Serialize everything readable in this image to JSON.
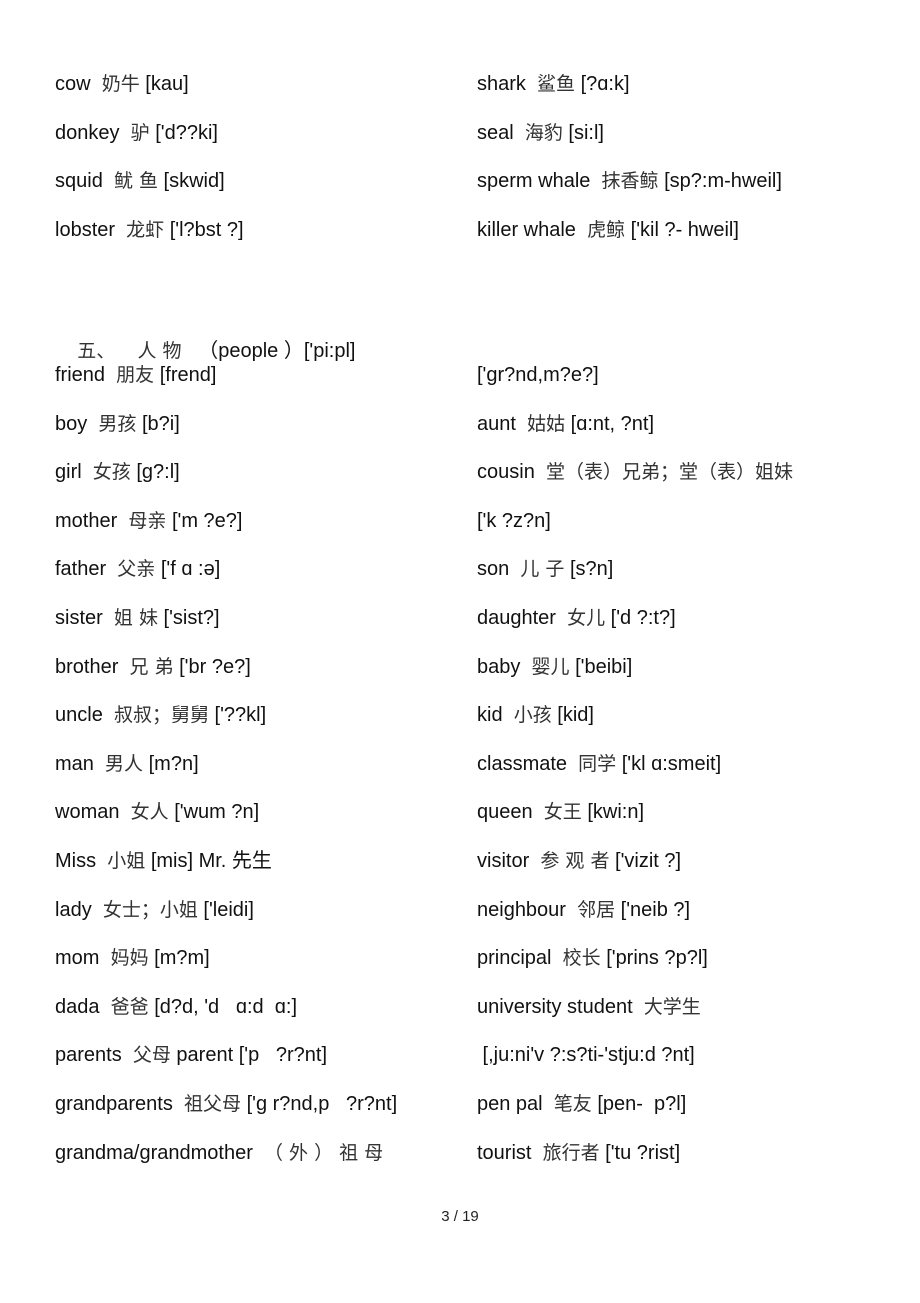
{
  "top_section": {
    "left": [
      {
        "en": "cow",
        "zh": "奶牛",
        "ipa": "[kau]"
      },
      {
        "en": "donkey",
        "zh": "驴",
        "ipa": "['d??ki]"
      },
      {
        "en": "squid",
        "zh": "鱿 鱼",
        "ipa": "[skwid]"
      },
      {
        "en": "lobster",
        "zh": "龙虾",
        "ipa": "['l?bst ?]"
      }
    ],
    "right": [
      {
        "en": "shark",
        "zh": "鲨鱼",
        "ipa": "[?ɑ:k]"
      },
      {
        "en": "seal",
        "zh": "海豹",
        "ipa": "[si:l]"
      },
      {
        "en": "sperm whale",
        "zh": "抹香鲸",
        "ipa": "[sp?:m-hweil]"
      },
      {
        "en": "killer whale",
        "zh": "虎鲸",
        "ipa": "['kil ?- hweil]"
      }
    ]
  },
  "section_heading": {
    "number": "五、",
    "title_zh": "人 物",
    "title_en": "（people ）",
    "ipa": "['pi:pl]"
  },
  "people": {
    "left": [
      {
        "en": "friend",
        "zh": "朋友",
        "ipa": "[frend]"
      },
      {
        "en": "boy",
        "zh": "男孩",
        "ipa": "[b?i]"
      },
      {
        "en": "girl",
        "zh": "女孩",
        "ipa": "[ɡ?:l]"
      },
      {
        "en": "mother",
        "zh": "母亲",
        "ipa": "['m ?e?]"
      },
      {
        "en": "father",
        "zh": "父亲",
        "ipa": "['f ɑ :ə]"
      },
      {
        "en": "sister",
        "zh": "姐 妹",
        "ipa": "['sist?]"
      },
      {
        "en": "brother",
        "zh": "兄 弟",
        "ipa": "['br ?e?]"
      },
      {
        "en": "uncle",
        "zh": "叔叔；舅舅",
        "ipa": "['??kl]"
      },
      {
        "en": "man",
        "zh": "男人",
        "ipa": "[m?n]"
      },
      {
        "en": "woman",
        "zh": "女人",
        "ipa": "['wum ?n]"
      },
      {
        "en": "Miss",
        "zh": "小姐",
        "ipa": "[mis] Mr. 先生"
      },
      {
        "en": "lady",
        "zh": "女士；小姐",
        "ipa": "['leidi]"
      },
      {
        "en": "mom",
        "zh": "妈妈",
        "ipa": "[m?m]"
      },
      {
        "en": "dada",
        "zh": "爸爸",
        "ipa": "[d?d, 'd   ɑ:d  ɑ:]"
      },
      {
        "en": "parents",
        "zh": "父母",
        "ipa": "parent ['p   ?r?nt]"
      },
      {
        "en": "grandparents",
        "zh": "祖父母",
        "ipa": "['ɡ r?nd,p   ?r?nt]"
      },
      {
        "en": "grandma/grandmother",
        "zh": "（ 外 ） 祖 母",
        "ipa": ""
      }
    ],
    "right": [
      {
        "en": "",
        "zh": "",
        "ipa": "['ɡr?nd,m?e?]"
      },
      {
        "en": "aunt",
        "zh": "姑姑",
        "ipa": "[ɑ:nt, ?nt]"
      },
      {
        "en": "cousin",
        "zh": "堂（表）兄弟；堂（表）姐妹",
        "ipa": ""
      },
      {
        "en": "",
        "zh": "",
        "ipa": "['k ?z?n]"
      },
      {
        "en": "son",
        "zh": "儿 子",
        "ipa": "[s?n]"
      },
      {
        "en": "daughter",
        "zh": "女儿",
        "ipa": "['d ?:t?]"
      },
      {
        "en": "baby",
        "zh": "婴儿",
        "ipa": "['beibi]"
      },
      {
        "en": "kid",
        "zh": "小孩",
        "ipa": "[kid]"
      },
      {
        "en": "classmate",
        "zh": "同学",
        "ipa": "['kl ɑ:smeit]"
      },
      {
        "en": "queen",
        "zh": "女王",
        "ipa": "[kwi:n]"
      },
      {
        "en": "visitor",
        "zh": "参 观 者",
        "ipa": "['vizit ?]"
      },
      {
        "en": "neighbour",
        "zh": "邻居",
        "ipa": "['neib ?]"
      },
      {
        "en": "principal",
        "zh": "校长",
        "ipa": "['prins ?p?l]"
      },
      {
        "en": "university student",
        "zh": "大学生",
        "ipa": ""
      },
      {
        "en": "",
        "zh": "",
        "ipa": " [,ju:ni'v ?:s?ti-'stju:d ?nt]"
      },
      {
        "en": "pen pal",
        "zh": "笔友",
        "ipa": "[pen-  p?l]"
      },
      {
        "en": "tourist",
        "zh": "旅行者",
        "ipa": "['tu ?rist]"
      }
    ]
  },
  "footer": {
    "page_current": "3",
    "separator": "/",
    "page_total": "19"
  }
}
